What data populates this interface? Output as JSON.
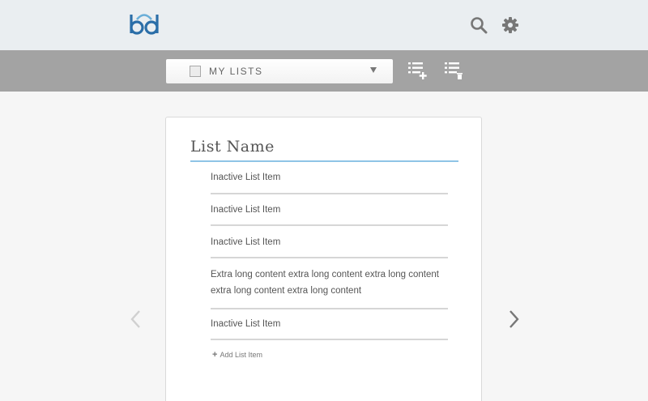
{
  "header": {
    "logo_text": "bd",
    "icons": {
      "search": "search-icon",
      "settings": "gear-icon"
    }
  },
  "toolbar": {
    "list_selector_label": "MY LISTS",
    "icons": {
      "add_list": "add-list-icon",
      "delete_list": "delete-list-icon",
      "dropdown": "chevron-down-icon"
    }
  },
  "card": {
    "list_name": "List Name",
    "items": [
      {
        "text": "Inactive List Item"
      },
      {
        "text": "Inactive List Item"
      },
      {
        "text": "Inactive List Item"
      },
      {
        "text": "Extra long content extra long content extra long content extra long content extra long content"
      },
      {
        "text": "Inactive List Item"
      }
    ],
    "add_item_label": "Add List Item"
  },
  "navigation": {
    "prev": "chevron-left-icon",
    "next": "chevron-right-icon"
  },
  "colors": {
    "header_bg": "#eaeef1",
    "toolbar_bg": "#a3a3a3",
    "brand": "#2b6ea8",
    "accent_rule": "#8fc4e6",
    "page_bg": "#f6f6f6"
  }
}
